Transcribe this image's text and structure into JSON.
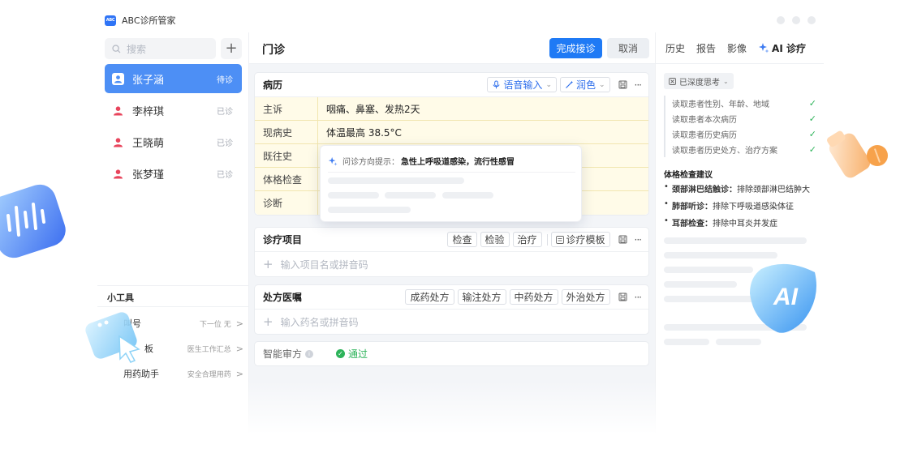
{
  "app": {
    "logo_text": "ABC",
    "title": "ABC诊所管家"
  },
  "sidebar": {
    "search_placeholder": "搜索",
    "add_label": "+",
    "patients": [
      {
        "name": "张子涵",
        "status": "待诊",
        "active": true
      },
      {
        "name": "李梓琪",
        "status": "已诊",
        "active": false
      },
      {
        "name": "王晓萌",
        "status": "已诊",
        "active": false
      },
      {
        "name": "张梦瑾",
        "status": "已诊",
        "active": false
      }
    ],
    "tools_title": "小工具",
    "tools": [
      {
        "name": "叫号",
        "desc": "下一位 无",
        "chevron": ">"
      },
      {
        "name": "板",
        "desc": "医生工作汇总",
        "chevron": ">"
      },
      {
        "name": "用药助手",
        "desc": "安全合理用药",
        "chevron": ">"
      }
    ]
  },
  "main": {
    "title": "门诊",
    "complete_button": "完成接诊",
    "cancel_button": "取消",
    "medical_record": {
      "title": "病历",
      "voice_input": "语音输入",
      "polish": "润色",
      "rows": [
        {
          "label": "主诉",
          "value": "咽痛、鼻塞、发热2天"
        },
        {
          "label": "现病史",
          "value": "体温最高 38.5°C"
        },
        {
          "label": "既往史",
          "value": ""
        },
        {
          "label": "体格检查",
          "value": ""
        },
        {
          "label": "诊断",
          "value": ""
        }
      ],
      "hint_prefix": "问诊方向提示：",
      "hint_text": "急性上呼吸道感染，流行性感冒"
    },
    "treatment": {
      "title": "诊疗项目",
      "chips": [
        "检查",
        "检验",
        "治疗"
      ],
      "template_label": "诊疗模板",
      "input_placeholder": "输入项目名或拼音码"
    },
    "prescription": {
      "title": "处方医嘱",
      "chips": [
        "成药处方",
        "输注处方",
        "中药处方",
        "外治处方"
      ],
      "input_placeholder": "输入药名或拼音码"
    },
    "audit": {
      "label": "智能审方",
      "result": "通过"
    }
  },
  "right_panel": {
    "tabs": [
      "历史",
      "报告",
      "影像"
    ],
    "ai_tab": "AI 诊疗",
    "deep_think": "已深度思考",
    "steps": [
      "读取患者性别、年龄、地域",
      "读取患者本次病历",
      "读取患者历史病历",
      "读取患者历史处方、治疗方案"
    ],
    "suggestion_title": "体格检查建议",
    "suggestions": [
      {
        "head": "颈部淋巴结触诊：",
        "text": "排除颈部淋巴结肿大"
      },
      {
        "head": "肺部听诊：",
        "text": "排除下呼吸道感染体征"
      },
      {
        "head": "耳部检查：",
        "text": "排除中耳炎并发症"
      }
    ]
  },
  "decorations": {
    "ai_badge_text": "AI"
  },
  "colors": {
    "primary": "#1f7af5",
    "active_patient": "#4d8ff5",
    "record_bg": "#fffbe8",
    "success": "#2db35a"
  }
}
